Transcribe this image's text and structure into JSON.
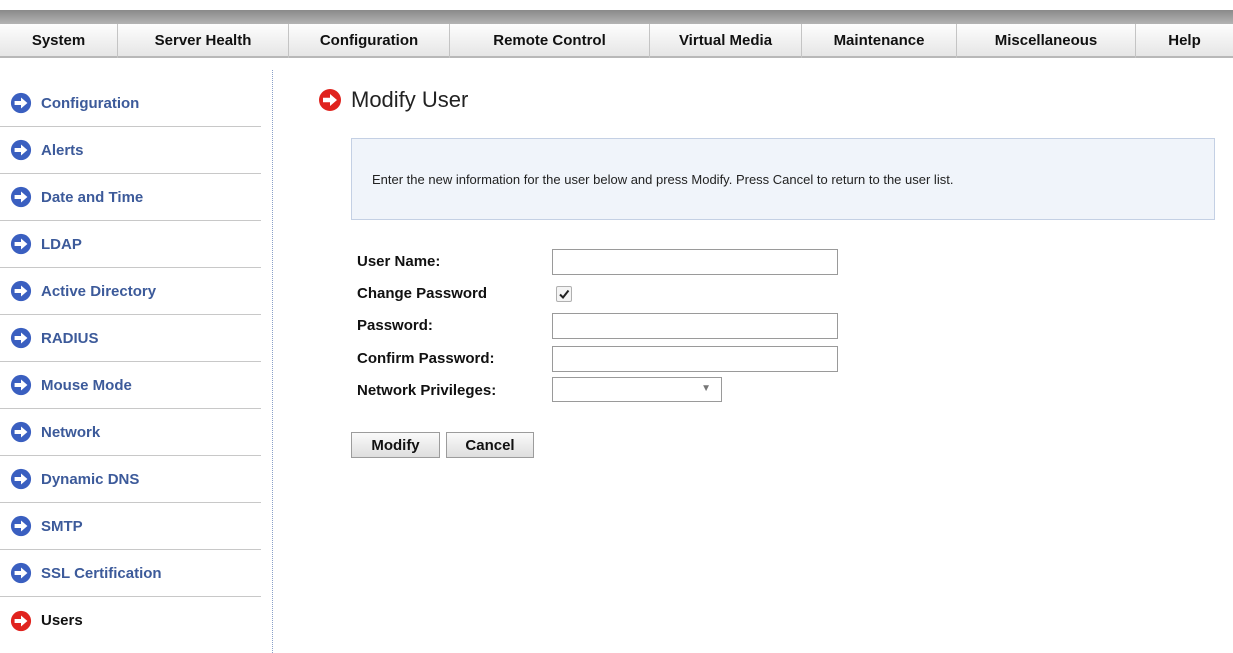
{
  "menubar": {
    "items": [
      "System",
      "Server Health",
      "Configuration",
      "Remote Control",
      "Virtual Media",
      "Maintenance",
      "Miscellaneous",
      "Help"
    ]
  },
  "sidebar": {
    "items": [
      {
        "label": "Configuration",
        "active": false
      },
      {
        "label": "Alerts",
        "active": false
      },
      {
        "label": "Date and Time",
        "active": false
      },
      {
        "label": "LDAP",
        "active": false
      },
      {
        "label": "Active Directory",
        "active": false
      },
      {
        "label": "RADIUS",
        "active": false
      },
      {
        "label": "Mouse Mode",
        "active": false
      },
      {
        "label": "Network",
        "active": false
      },
      {
        "label": "Dynamic DNS",
        "active": false
      },
      {
        "label": "SMTP",
        "active": false
      },
      {
        "label": "SSL Certification",
        "active": false
      },
      {
        "label": "Users",
        "active": true
      }
    ]
  },
  "page": {
    "title": "Modify User",
    "info": "Enter the new information for the user below and press Modify. Press Cancel to return to the user list."
  },
  "form": {
    "user_name_label": "User Name:",
    "user_name_value": "",
    "change_password_label": "Change Password",
    "change_password_checked": true,
    "password_label": "Password:",
    "password_value": "",
    "confirm_password_label": "Confirm Password:",
    "confirm_password_value": "",
    "network_privileges_label": "Network Privileges:",
    "network_privileges_value": ""
  },
  "buttons": {
    "modify": "Modify",
    "cancel": "Cancel"
  },
  "colors": {
    "nav_icon": "#3a5fc0",
    "active_icon": "#e0231e",
    "nav_text": "#3c5a9a"
  },
  "icons": {
    "nav": "arrow-right-circle-icon",
    "active": "arrow-right-circle-icon"
  }
}
